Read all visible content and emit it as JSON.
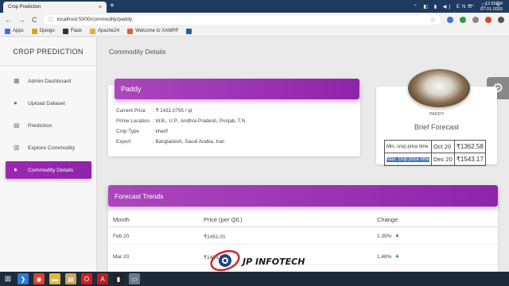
{
  "browser": {
    "tab_title": "Crop Prediction",
    "tab_close": "×",
    "new_tab": "+",
    "win_min": "—",
    "win_max": "□",
    "win_close": "×",
    "back": "←",
    "forward": "→",
    "reload": "C",
    "info_icon": "ⓘ",
    "url": "localhost:5000/commodity/paddy",
    "star": "☆",
    "bookmarks": [
      {
        "label": "Apps",
        "color": "#4a6fd8"
      },
      {
        "label": "Django",
        "color": "#e0a020"
      },
      {
        "label": "Flask",
        "color": "#333333"
      },
      {
        "label": "Apache24",
        "color": "#e8b033"
      },
      {
        "label": "Welcome to XAMPP",
        "color": "#e06030"
      },
      {
        "label": "",
        "color": "#1e5fa8"
      }
    ]
  },
  "sidebar": {
    "brand": "CROP PREDICTION",
    "items": [
      {
        "label": "Admin Dashboard",
        "icon": "dashboard-icon",
        "glyph": "▦"
      },
      {
        "label": "Upload Dataset",
        "icon": "person-icon",
        "glyph": "●"
      },
      {
        "label": "Prediction",
        "icon": "document-icon",
        "glyph": "▤"
      },
      {
        "label": "Explore Commodity",
        "icon": "library-icon",
        "glyph": "▥"
      },
      {
        "label": "Commodity Details",
        "icon": "bubbles-icon",
        "glyph": "●"
      }
    ],
    "active_index": 4
  },
  "main": {
    "page_title": "Commodity Details",
    "gear_glyph": "⚙",
    "commodity_card": {
      "header": "Paddy",
      "rows": [
        {
          "key": "Current Price",
          "value": ": ₹ 1431.0795 / ql"
        },
        {
          "key": "Prime Location",
          "value": ": W.B., U.P., Andhra Pradesh, Punjab, T.N."
        },
        {
          "key": "Crop Type",
          "value": ": kharif"
        },
        {
          "key": "Export",
          "value": ": Bangladesh, Saudi Arabia, Iran"
        }
      ]
    },
    "forecast_card": {
      "image_caption": "PADDY",
      "title": "Brief Forecast",
      "min_label": "Min. crop price time",
      "min_month": "Oct 20",
      "min_value": "₹1362.58",
      "max_label": "Max. crop price time",
      "max_month": "Dec 20",
      "max_value": "₹1543.17"
    },
    "trends": {
      "header": "Forecast Trends",
      "columns": [
        "Month",
        "Price (per Qtl.)",
        "Change"
      ],
      "rows": [
        {
          "month": "Feb 20",
          "price": "₹1451.01",
          "change": "1.39%",
          "arrow": "▲"
        },
        {
          "month": "Mar 20",
          "price": "₹1463.27",
          "change": "1.48%",
          "arrow": "▲"
        }
      ]
    }
  },
  "watermark": {
    "text": "JP INFOTECH"
  },
  "taskbar": {
    "apps": [
      {
        "icon": "vscode-icon",
        "color": "#2a7bd5",
        "glyph": "❯"
      },
      {
        "icon": "chrome-icon",
        "color": "#d9442a",
        "glyph": "◉"
      },
      {
        "icon": "explorer-icon",
        "color": "#e6b93b",
        "glyph": "▬"
      },
      {
        "icon": "files-icon",
        "color": "#c8a75a",
        "glyph": "▤"
      },
      {
        "icon": "opera-icon",
        "color": "#cc1f1f",
        "glyph": "O"
      },
      {
        "icon": "pdf-icon",
        "color": "#b51f1f",
        "glyph": "A"
      },
      {
        "icon": "terminal-icon",
        "color": "#222222",
        "glyph": "▮"
      },
      {
        "icon": "window-icon",
        "color": "#6a7a8a",
        "glyph": "▭"
      }
    ],
    "tray": "⌃ ◧ ▮ ◀) ENG",
    "time": "12:55PM",
    "date": "07-01-2020"
  }
}
